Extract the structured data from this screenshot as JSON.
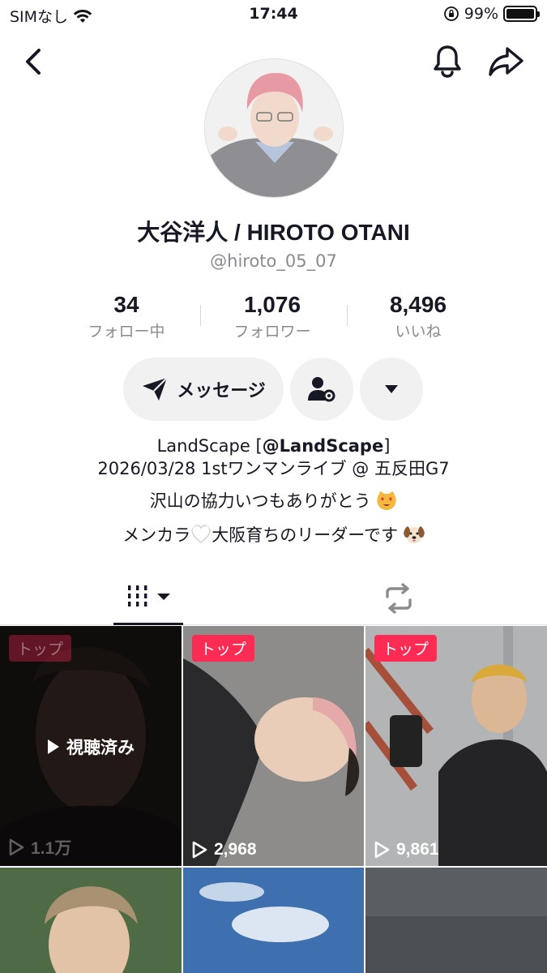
{
  "status_bar": {
    "carrier": "SIMなし",
    "time": "17:44",
    "battery": "99%",
    "battery_level": 0.99
  },
  "profile": {
    "display_name": "大谷洋人 / HIROTO OTANI",
    "username": "@hiroto_05_07"
  },
  "stats": [
    {
      "value": "34",
      "label": "フォロー中"
    },
    {
      "value": "1,076",
      "label": "フォロワー"
    },
    {
      "value": "8,496",
      "label": "いいね"
    }
  ],
  "actions": {
    "message_label": "メッセージ"
  },
  "bio": {
    "line1_prefix": "LandScape [",
    "line1_mention": "@LandScape",
    "line1_suffix": "]",
    "line2": "2026/03/28 1stワンマンライブ @ 五反田G7",
    "line3": "沢山の協力いつもありがとう",
    "line4_a": "メンカラ",
    "line4_b": "大阪育ちのリーダーです"
  },
  "videos": [
    {
      "tag": "トップ",
      "views": "1.1万",
      "watched_label": "視聴済み",
      "watched": true
    },
    {
      "tag": "トップ",
      "views": "2,968",
      "watched": false
    },
    {
      "tag": "トップ",
      "views": "9,861",
      "watched": false
    },
    {
      "tag": "",
      "views": "",
      "watched": false
    },
    {
      "tag": "",
      "views": "",
      "watched": false
    },
    {
      "tag": "",
      "views": "",
      "watched": false
    }
  ],
  "colors": {
    "accent": "#fe2c55",
    "text": "#161823",
    "muted": "#8a8b91",
    "button_bg": "#f1f1f2"
  },
  "icons": [
    "back-icon",
    "bell-icon",
    "share-icon",
    "send-icon",
    "person-settings-icon",
    "dropdown-icon",
    "grid-icon",
    "repost-icon",
    "play-icon"
  ]
}
